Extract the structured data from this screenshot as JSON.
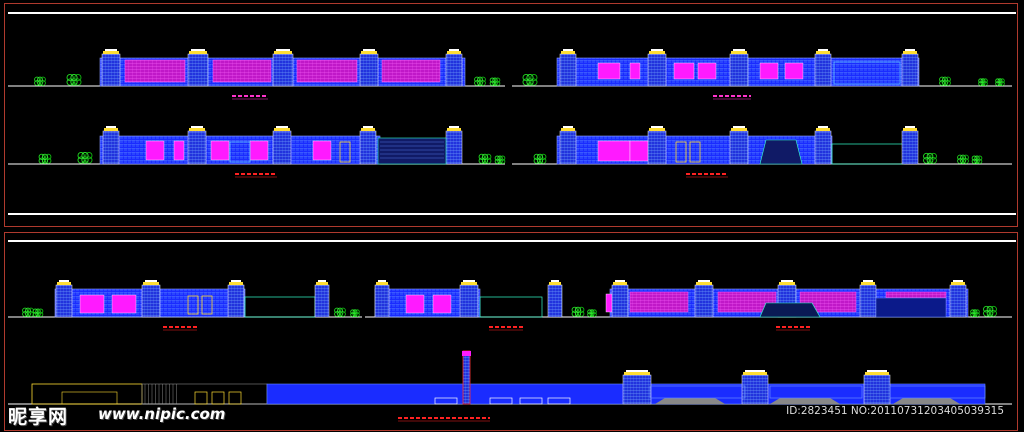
{
  "watermark": {
    "logo": "昵享网",
    "url": "www.nipic.com",
    "id_text": "ID:2823451 NO:20110731203405039315"
  },
  "colors": {
    "background": "#000000",
    "frame": "#c0392b",
    "facade_blue": "#1a2cff",
    "glass_magenta": "#ff1aff",
    "trees": "#22dd22",
    "ground": "#ffffff",
    "label_red": "#ff2222",
    "label_magenta": "#ff33cc"
  },
  "drawing_type": "CAD building elevation sheets",
  "elevations": [
    {
      "id": "e1",
      "label_color": "magenta"
    },
    {
      "id": "e2",
      "label_color": "magenta"
    },
    {
      "id": "e3",
      "label_color": "red"
    },
    {
      "id": "e4",
      "label_color": "red"
    },
    {
      "id": "e5",
      "label_color": "red"
    },
    {
      "id": "e6",
      "label_color": "red"
    },
    {
      "id": "e7",
      "label_color": "red"
    },
    {
      "id": "e8",
      "label_color": "red"
    }
  ]
}
